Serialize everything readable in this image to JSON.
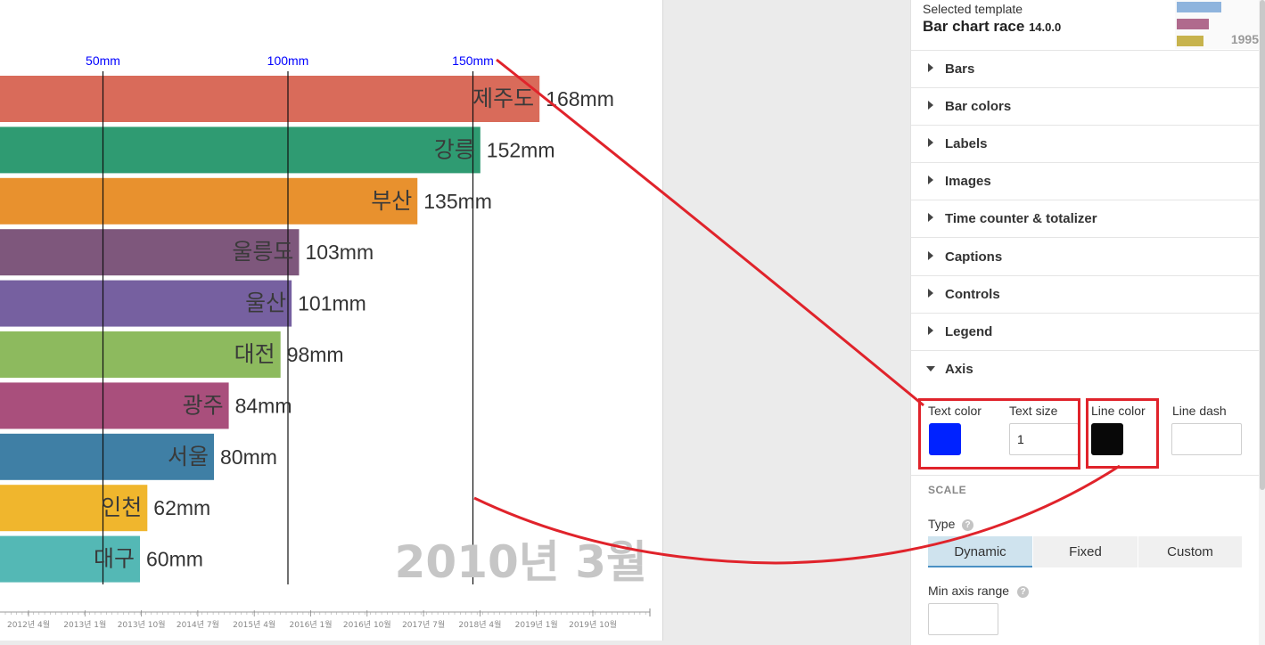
{
  "chart_data": {
    "type": "bar",
    "unit": "mm",
    "categories": [
      "제주도",
      "강릉",
      "부산",
      "울릉도",
      "울산",
      "대전",
      "광주",
      "서울",
      "인천",
      "대구"
    ],
    "values": [
      168,
      152,
      135,
      103,
      101,
      98,
      84,
      80,
      62,
      60
    ],
    "value_labels": [
      "168mm",
      "152mm",
      "135mm",
      "103mm",
      "101mm",
      "98mm",
      "84mm",
      "80mm",
      "62mm",
      "60mm"
    ],
    "colors": [
      "#d96b5a",
      "#2f9b72",
      "#e8912e",
      "#7e577c",
      "#7660a0",
      "#8dba5e",
      "#a94f7c",
      "#3f7fa5",
      "#f0b62d",
      "#54b8b5"
    ],
    "x_ticks": [
      50,
      100,
      150
    ],
    "x_tick_labels": [
      "50mm",
      "100mm",
      "150mm"
    ],
    "axis_text_color": "#0000ff",
    "grid": true,
    "time_label": "2010년 3월",
    "timeline_labels": [
      "2012년 4월",
      "2013년 1월",
      "2013년 10월",
      "2014년 7월",
      "2015년 4월",
      "2016년 1월",
      "2016년 10월",
      "2017년 7월",
      "2018년 4월",
      "2019년 1월",
      "2019년 10월"
    ]
  },
  "template": {
    "selected_label": "Selected template",
    "name": "Bar chart race",
    "version": "14.0.0",
    "thumb_year": "1995"
  },
  "sections": [
    "Bars",
    "Bar colors",
    "Labels",
    "Images",
    "Time counter & totalizer",
    "Captions",
    "Controls",
    "Legend",
    "Axis"
  ],
  "axis": {
    "text_color_label": "Text color",
    "text_color": "#0022ff",
    "text_size_label": "Text size",
    "text_size": "1",
    "line_color_label": "Line color",
    "line_color": "#080808",
    "line_dash_label": "Line dash",
    "line_dash": ""
  },
  "scale": {
    "title": "SCALE",
    "type_label": "Type",
    "types": [
      "Dynamic",
      "Fixed",
      "Custom"
    ],
    "active_type": "Dynamic",
    "min_range_label": "Min axis range",
    "help_glyph": "?"
  },
  "annotation_color": "#e0232b"
}
